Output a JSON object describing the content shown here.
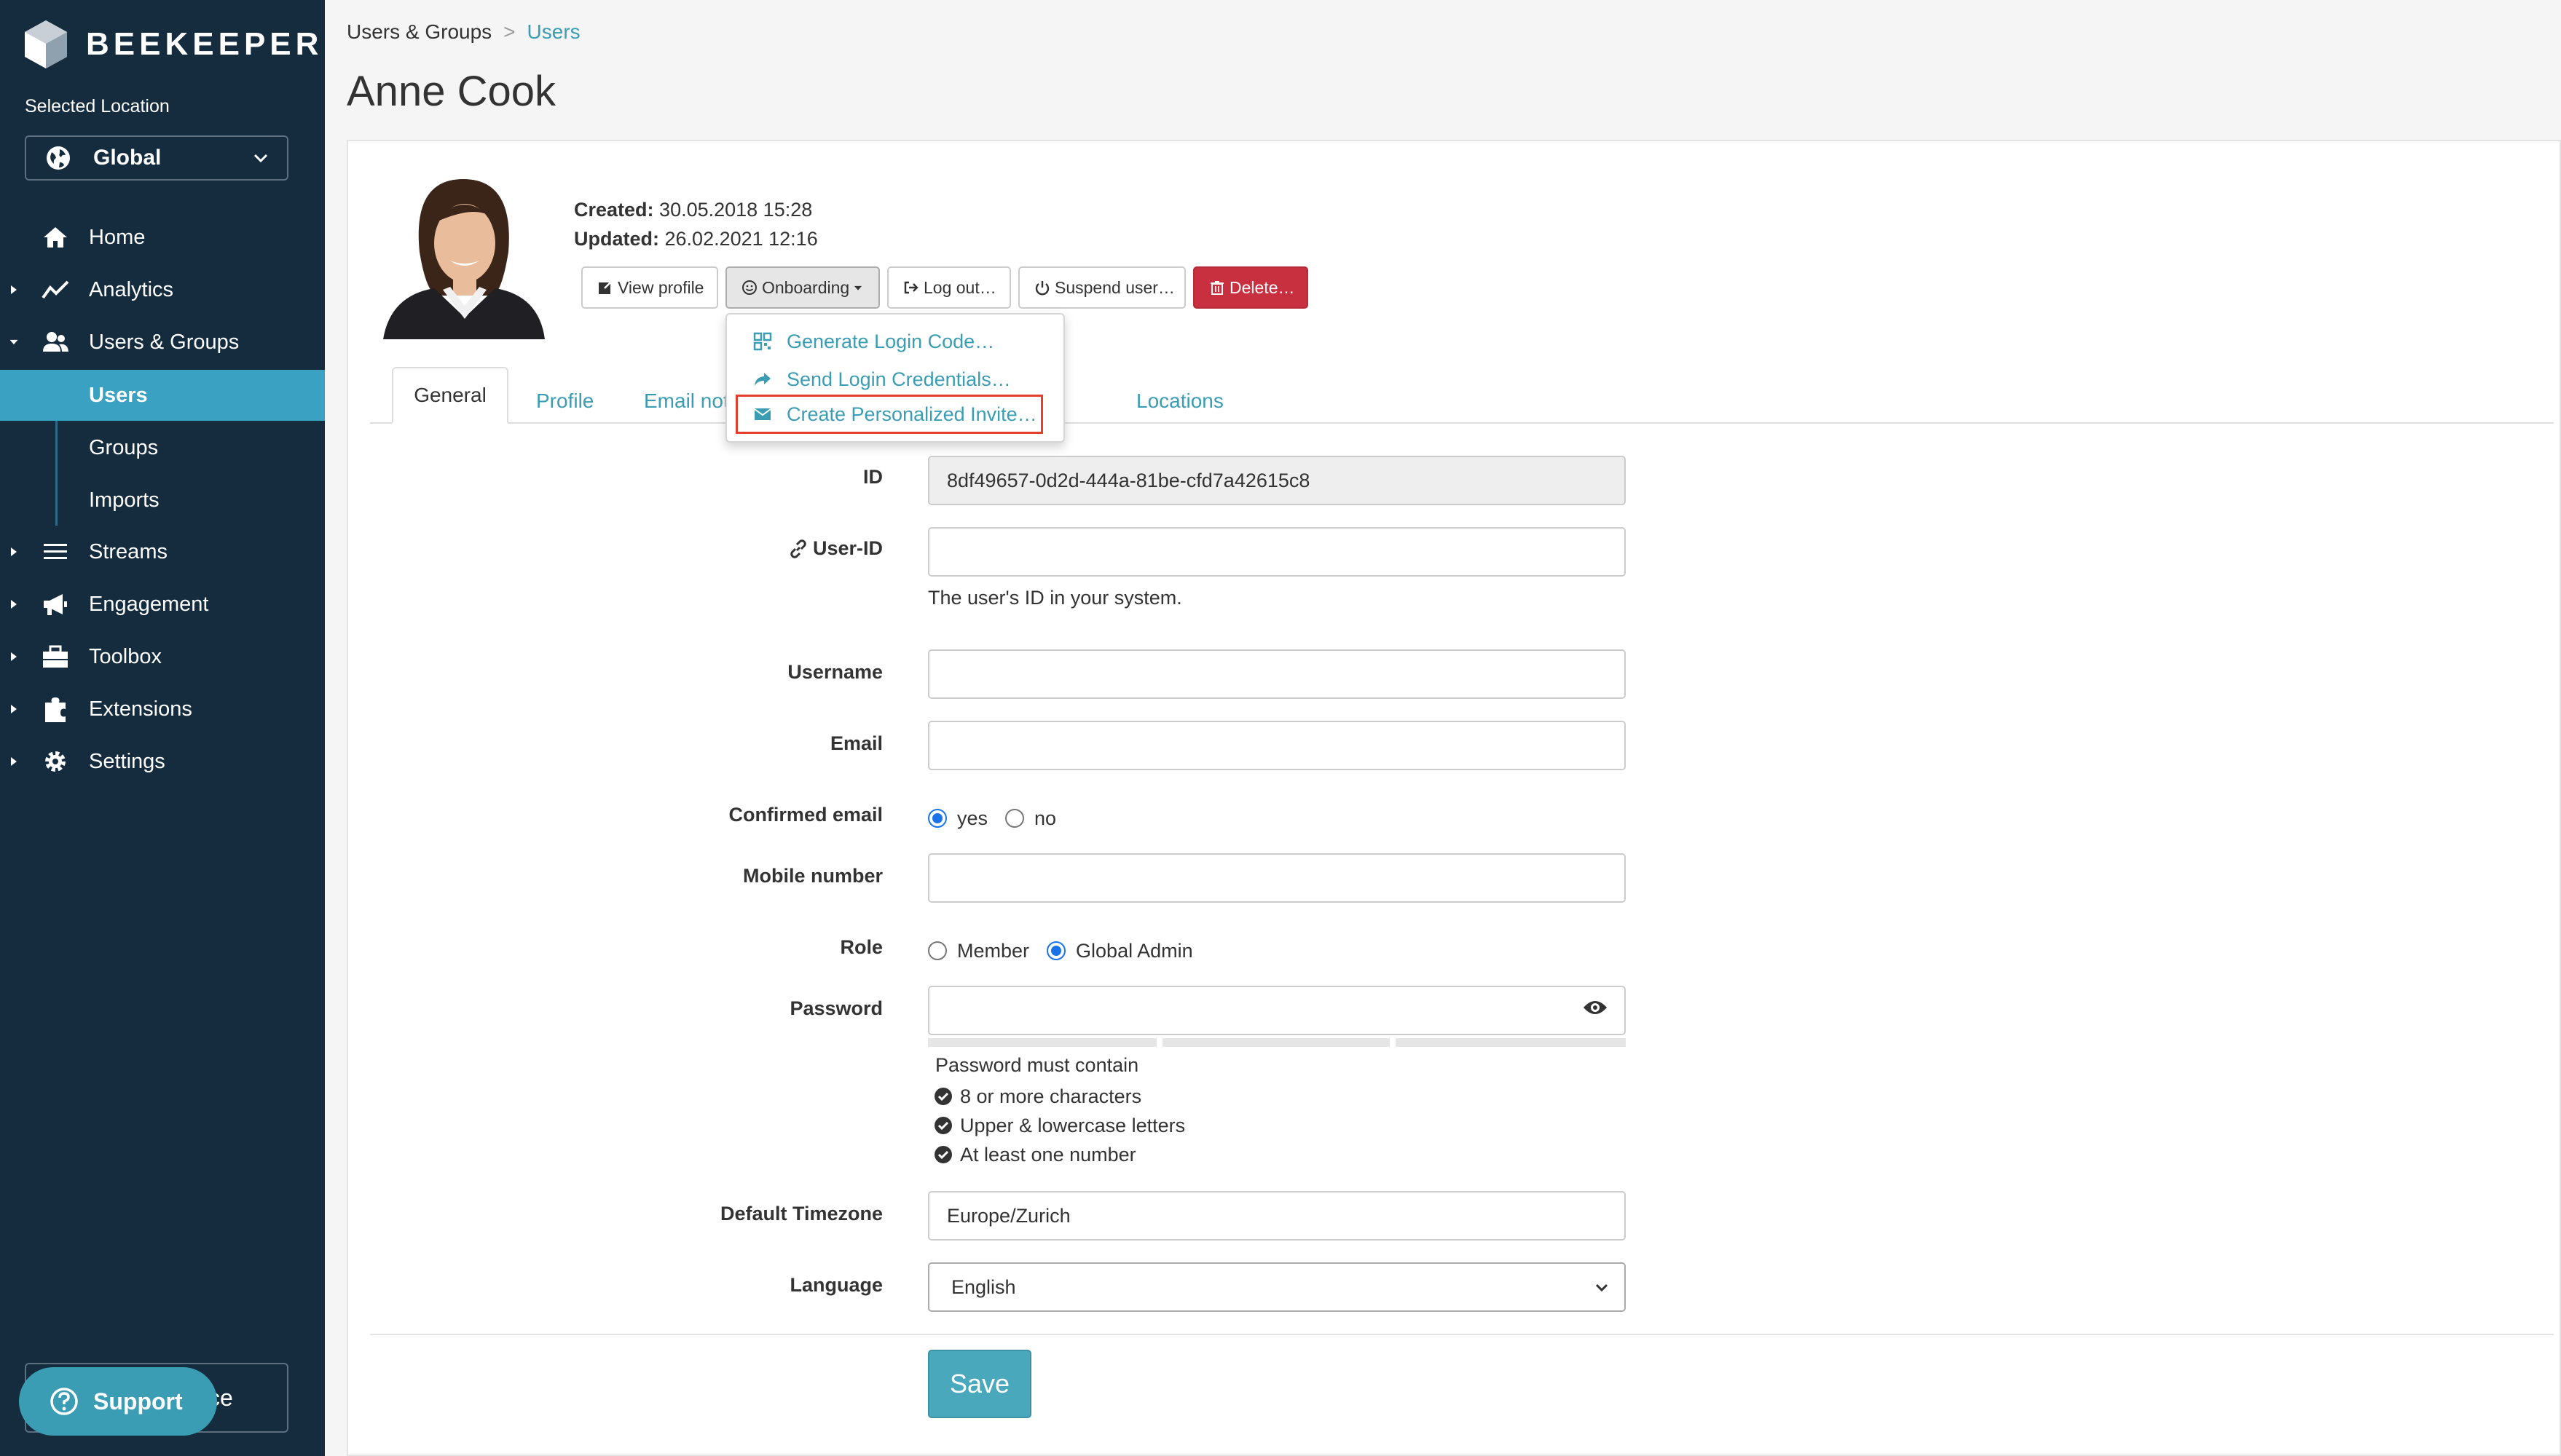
{
  "brand": {
    "name": "BEEKEEPER"
  },
  "location": {
    "caption": "Selected Location",
    "value": "Global"
  },
  "sidebar": {
    "items": [
      {
        "label": "Home",
        "icon": "home-icon"
      },
      {
        "label": "Analytics",
        "icon": "analytics-icon"
      },
      {
        "label": "Users & Groups",
        "icon": "users-icon"
      },
      {
        "label": "Streams",
        "icon": "streams-icon"
      },
      {
        "label": "Engagement",
        "icon": "megaphone-icon"
      },
      {
        "label": "Toolbox",
        "icon": "toolbox-icon"
      },
      {
        "label": "Extensions",
        "icon": "puzzle-icon"
      },
      {
        "label": "Settings",
        "icon": "gear-icon"
      }
    ],
    "sub_items": [
      {
        "label": "Users",
        "active": true
      },
      {
        "label": "Groups",
        "active": false
      },
      {
        "label": "Imports",
        "active": false
      }
    ],
    "bottom_partial": "ce",
    "support": "Support"
  },
  "breadcrumb": {
    "parent": "Users & Groups",
    "sep": ">",
    "current": "Users"
  },
  "page_title": "Anne Cook",
  "meta": {
    "created_label": "Created:",
    "created_value": "30.05.2018 15:28",
    "updated_label": "Updated:",
    "updated_value": "26.02.2021 12:16"
  },
  "actions": {
    "view_profile": "View profile",
    "onboarding": "Onboarding",
    "logout": "Log out…",
    "suspend": "Suspend user…",
    "delete": "Delete…"
  },
  "onboarding_menu": [
    "Generate Login Code…",
    "Send Login Credentials…",
    "Create Personalized Invite…"
  ],
  "tabs": [
    "General",
    "Profile",
    "Email not",
    "Locations"
  ],
  "form": {
    "id_label": "ID",
    "id_value": "8df49657-0d2d-444a-81be-cfd7a42615c8",
    "userid_label": "User-ID",
    "userid_help": "The user's ID in your system.",
    "username_label": "Username",
    "email_label": "Email",
    "confirmed_label": "Confirmed email",
    "confirmed_yes": "yes",
    "confirmed_no": "no",
    "mobile_label": "Mobile number",
    "role_label": "Role",
    "role_member": "Member",
    "role_admin": "Global Admin",
    "password_label": "Password",
    "pw_title": "Password must contain",
    "pw_req1": "8 or more characters",
    "pw_req2": "Upper & lowercase letters",
    "pw_req3": "At least one number",
    "tz_label": "Default Timezone",
    "tz_value": "Europe/Zurich",
    "lang_label": "Language",
    "lang_value": "English",
    "save": "Save"
  },
  "colors": {
    "sidebar": "#152c3f",
    "accent": "#3aa1c2",
    "danger": "#c9303f",
    "highlight": "#e2402d"
  }
}
